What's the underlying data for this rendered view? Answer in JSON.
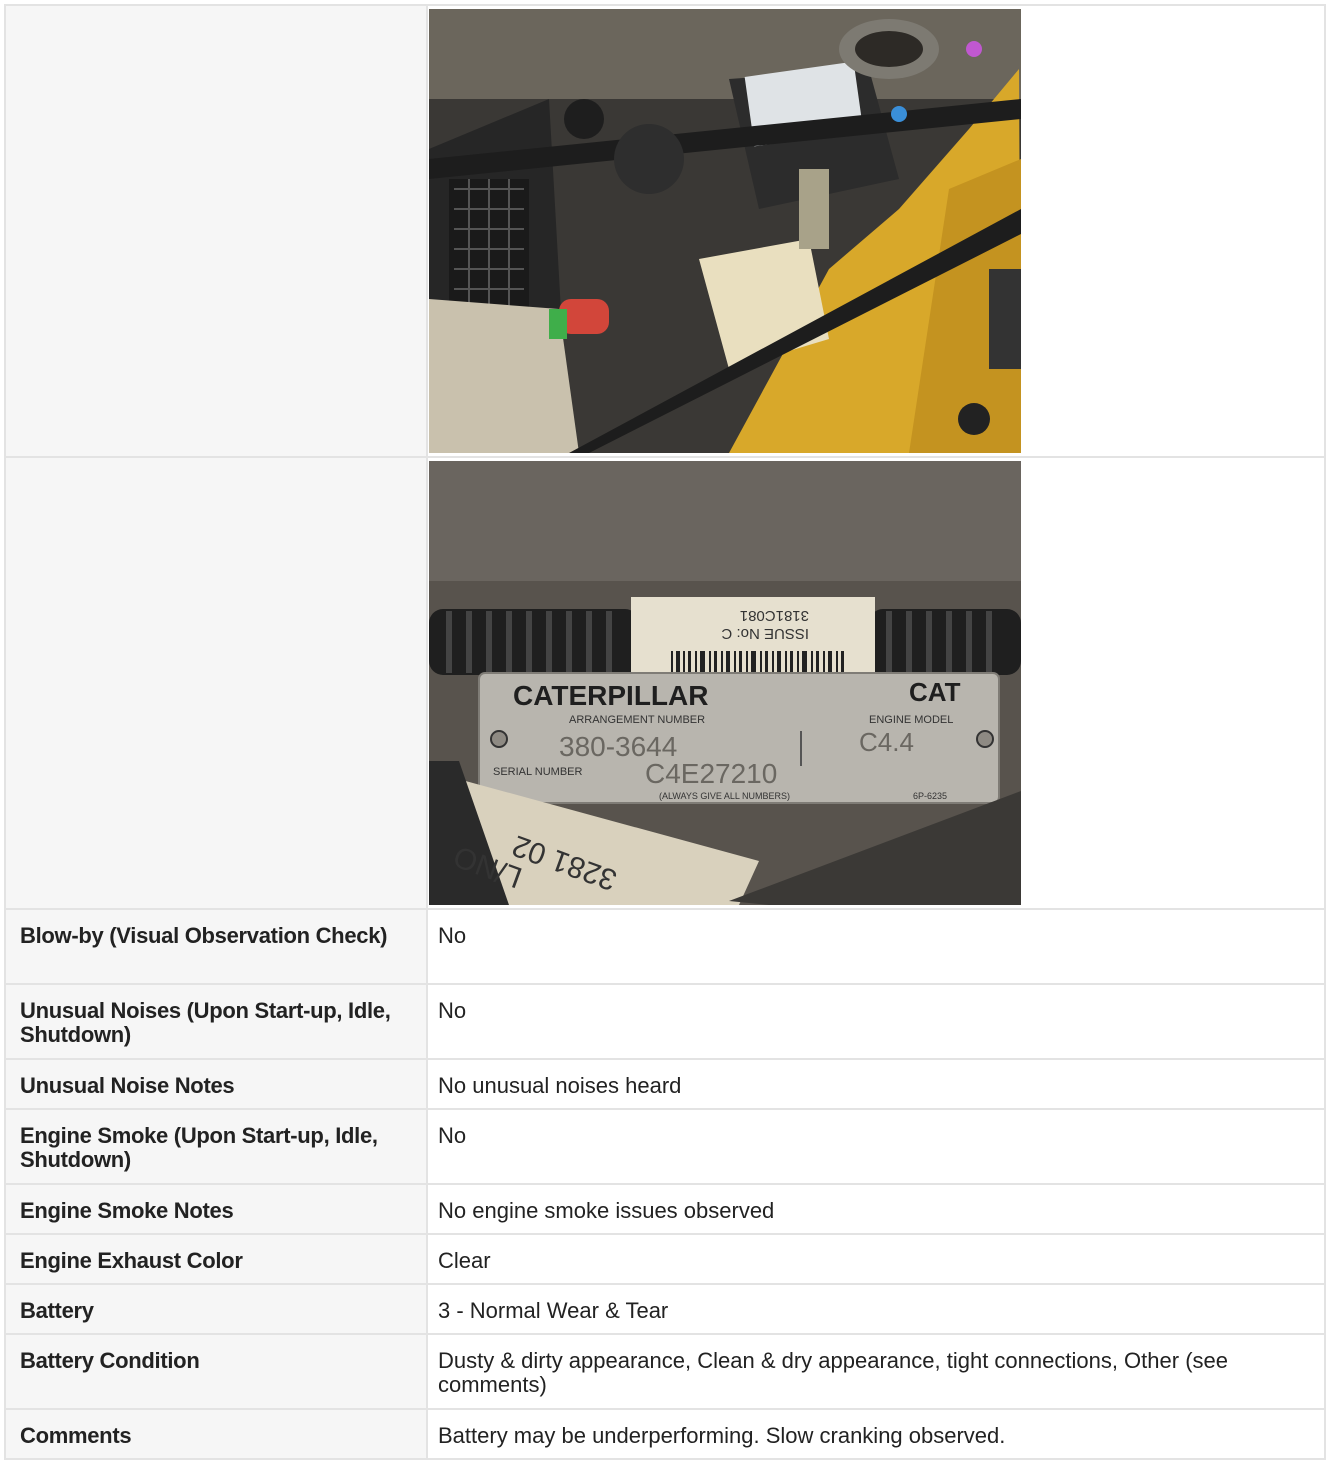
{
  "photos": [
    {
      "icon": "engine-bay-photo",
      "description_hidden": true
    },
    {
      "icon": "serial-plate-photo",
      "plate": {
        "brand": "CATERPILLAR",
        "cat_mark": "CAT",
        "arrangement_label": "ARRANGEMENT NUMBER",
        "arrangement_number": "380-3644",
        "model_label": "ENGINE MODEL",
        "model": "C4.4",
        "serial_label": "SERIAL NUMBER",
        "serial_number": "C4E27210",
        "footer": "(ALWAYS GIVE ALL NUMBERS)",
        "part_code": "6P-6235"
      },
      "sticker": {
        "issue": "ISSUE No: C",
        "code": "3181C081"
      },
      "hose_text": "3281 02",
      "hose_text2": "L/NO"
    }
  ],
  "rows": [
    {
      "label": "Blow-by (Visual Observation Check)",
      "value": "No"
    },
    {
      "label": "Unusual Noises (Upon Start-up, Idle, Shutdown)",
      "value": "No"
    },
    {
      "label": "Unusual Noise Notes",
      "value": "No unusual noises heard"
    },
    {
      "label": "Engine Smoke (Upon Start-up, Idle, Shutdown)",
      "value": "No"
    },
    {
      "label": "Engine Smoke Notes",
      "value": "No engine smoke issues observed"
    },
    {
      "label": "Engine Exhaust Color",
      "value": "Clear"
    },
    {
      "label": "Battery",
      "value": "3 - Normal Wear & Tear"
    },
    {
      "label": "Battery Condition",
      "value": "Dusty & dirty appearance, Clean & dry appearance, tight connections, Other (see comments)"
    },
    {
      "label": "Comments",
      "value": "Battery may be underperforming. Slow cranking observed."
    }
  ]
}
